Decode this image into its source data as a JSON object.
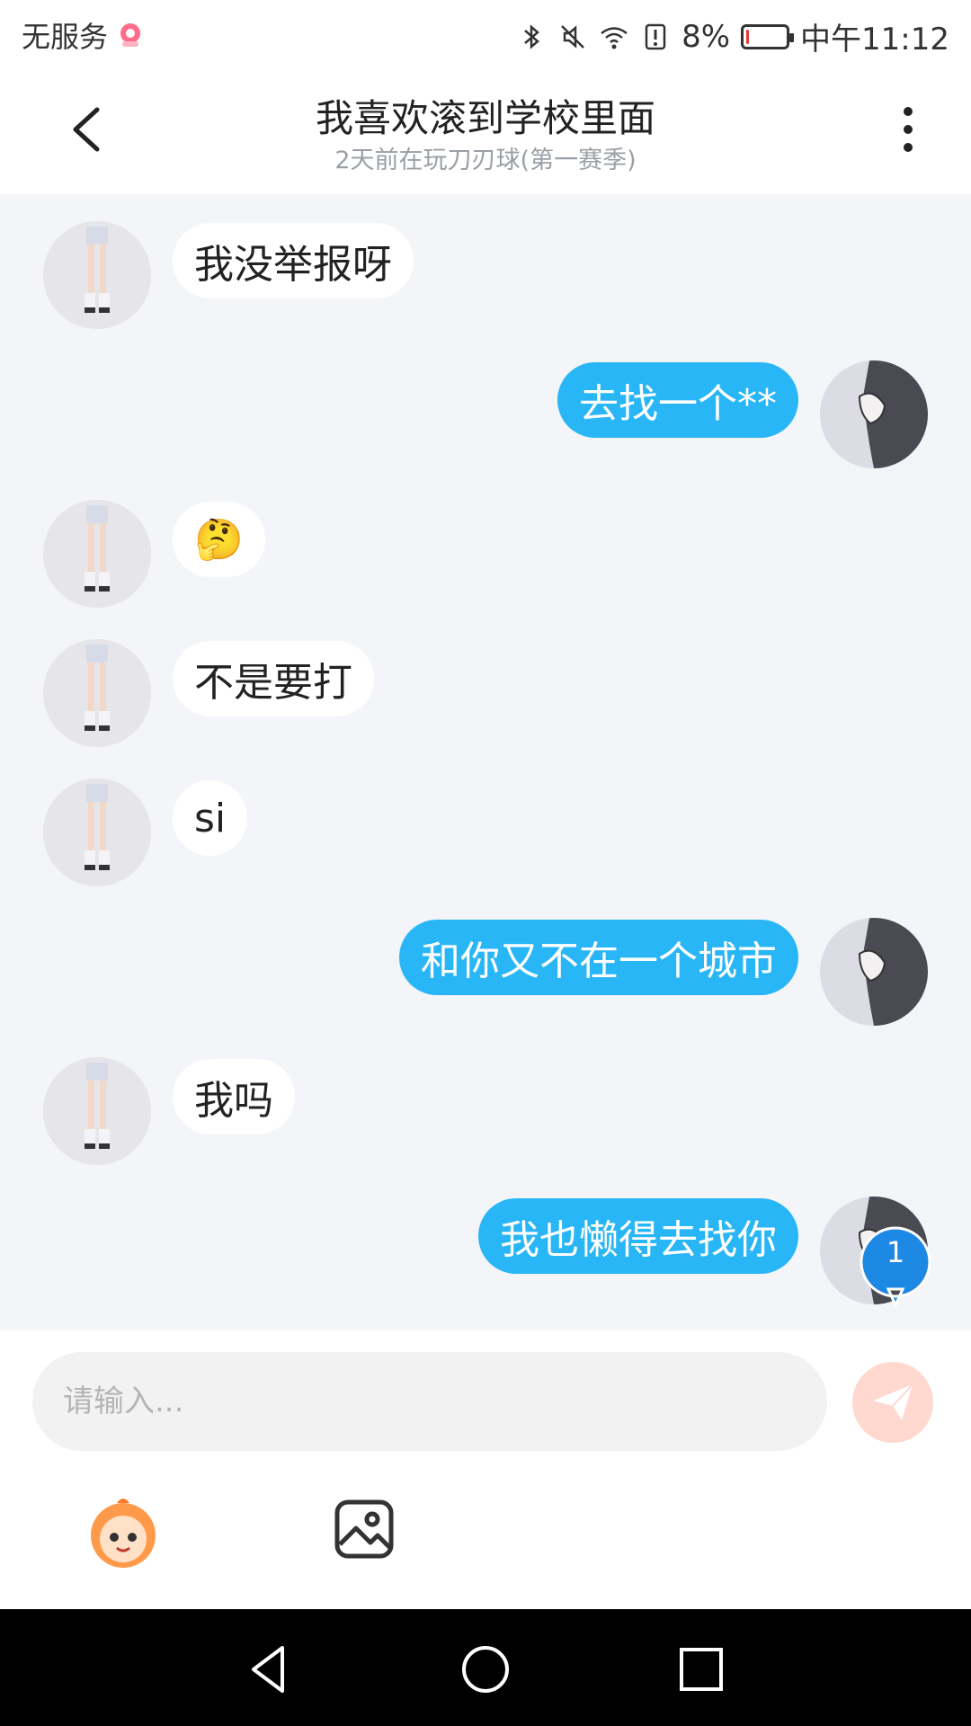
{
  "status_bar": {
    "carrier": "无服务",
    "battery_percent": "8%",
    "time": "中午11:12",
    "battery_level": 0.08,
    "icons": [
      "bluetooth-icon",
      "mute-icon",
      "wifi-icon",
      "sim-alert-icon"
    ]
  },
  "header": {
    "title": "我喜欢滚到学校里面",
    "subtitle": "2天前在玩刀刃球(第一赛季)"
  },
  "messages": [
    {
      "side": "left",
      "text": "我没举报呀"
    },
    {
      "side": "right",
      "text": "去找一个**"
    },
    {
      "side": "left",
      "text": "🤔"
    },
    {
      "side": "left",
      "text": "不是要打"
    },
    {
      "side": "left",
      "text": "si"
    },
    {
      "side": "right",
      "text": "和你又不在一个城市"
    },
    {
      "side": "left",
      "text": "我吗"
    },
    {
      "side": "right",
      "text": "我也懒得去找你"
    }
  ],
  "unread_badge": "1",
  "composer": {
    "placeholder": "请输入..."
  },
  "colors": {
    "outgoing_bubble": "#29b6f6",
    "incoming_bubble": "#ffffff",
    "chat_background": "#f3f5f8",
    "send_button": "#ffd8d0"
  }
}
